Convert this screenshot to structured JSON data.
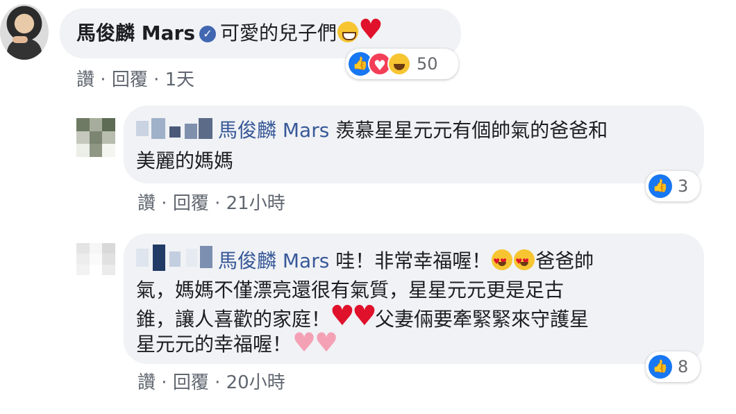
{
  "comments": [
    {
      "author": "馬俊麟 Mars",
      "text": "可愛的兒子們",
      "actions": {
        "like": "讚",
        "reply": "回覆",
        "time": "1天"
      },
      "reactions": {
        "icons": [
          "like-icon",
          "love-icon",
          "haha-icon"
        ],
        "count": "50"
      }
    },
    {
      "tag": "馬俊麟 Mars",
      "text_line1": "羨慕星星元元有個帥氣的爸爸和",
      "text_line2": "美麗的媽媽",
      "actions": {
        "like": "讚",
        "reply": "回覆",
        "time": "21小時"
      },
      "reactions": {
        "icons": [
          "like-icon"
        ],
        "count": "3"
      }
    },
    {
      "tag": "馬俊麟 Mars",
      "text_line1a": "哇！非常幸福喔！",
      "text_line1b": "爸爸帥",
      "text_line2": "氣，媽媽不僅漂亮還很有氣質，星星元元更是足古",
      "text_line3a": "錐，讓人喜歡的家庭！",
      "text_line3b": "父妻倆要牽緊緊來守護星",
      "text_line4": "星元元的幸福喔！",
      "actions": {
        "like": "讚",
        "reply": "回覆",
        "time": "20小時"
      },
      "reactions": {
        "icons": [
          "like-icon"
        ],
        "count": "8"
      }
    }
  ],
  "separator": " · "
}
